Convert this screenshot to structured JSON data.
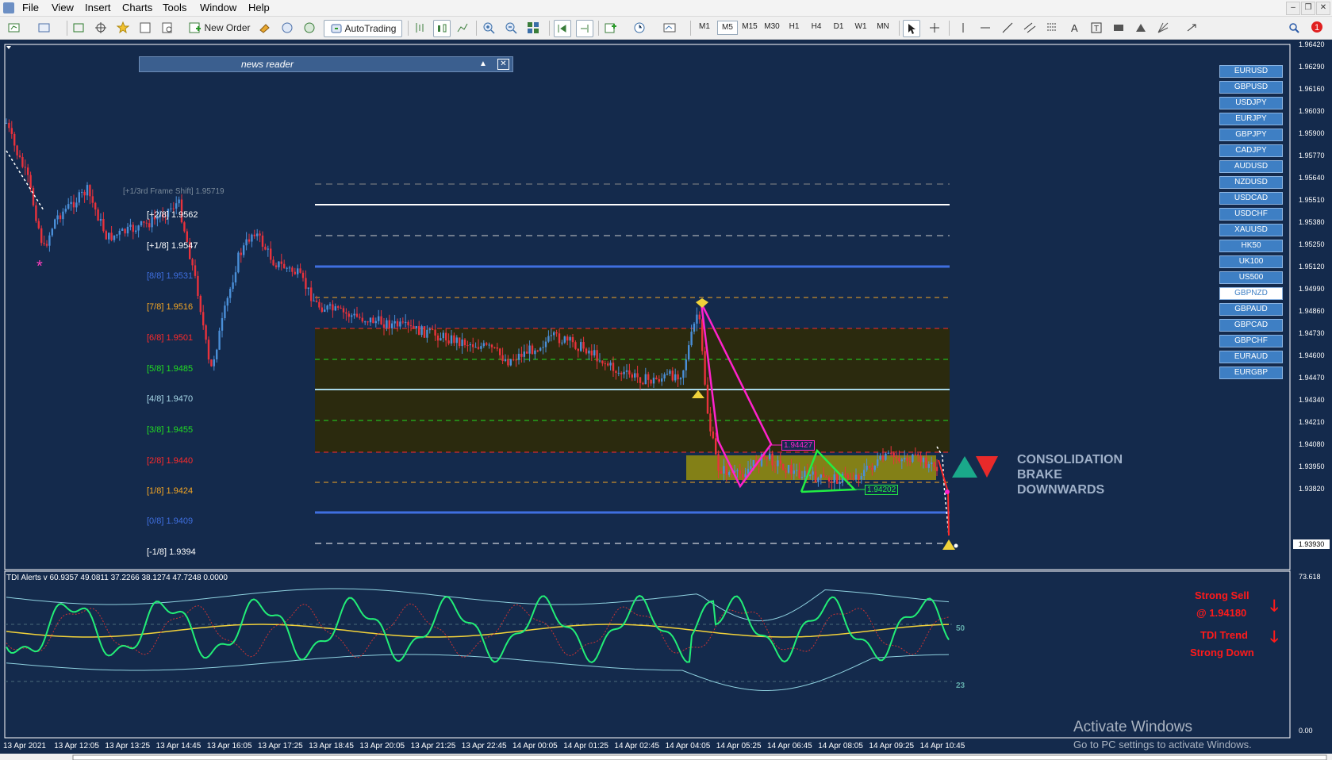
{
  "menu": [
    "File",
    "View",
    "Insert",
    "Charts",
    "Tools",
    "Window",
    "Help"
  ],
  "toolbar": {
    "new_order": "New Order",
    "autotrading": "AutoTrading",
    "timeframes": [
      "M1",
      "M5",
      "M15",
      "M30",
      "H1",
      "H4",
      "D1",
      "W1",
      "MN"
    ],
    "active_timeframe": "M5",
    "notification_count": "1"
  },
  "news_reader": {
    "title": "news reader",
    "minimize": "▲",
    "close": "✕"
  },
  "price_axis": [
    "1.96420",
    "1.96290",
    "1.96160",
    "1.96030",
    "1.95900",
    "1.95770",
    "1.95640",
    "1.95510",
    "1.95380",
    "1.95250",
    "1.95120",
    "1.94990",
    "1.94860",
    "1.94730",
    "1.94600",
    "1.94470",
    "1.94340",
    "1.94210",
    "1.94080",
    "1.93950",
    "1.93820"
  ],
  "current_price": "1.93930",
  "murrey_levels": [
    {
      "tag": "[+1/3rd Frame Shift]",
      "value": "1.95719",
      "color": "#7a8a9a"
    },
    {
      "tag": "[+2/8]",
      "value": "1.9562",
      "color": "#ffffff"
    },
    {
      "tag": "[+1/8]",
      "value": "1.9547",
      "color": "#ffffff"
    },
    {
      "tag": "[8/8]",
      "value": "1.9531",
      "color": "#3f6fe0"
    },
    {
      "tag": "[7/8]",
      "value": "1.9516",
      "color": "#f5a623"
    },
    {
      "tag": "[6/8]",
      "value": "1.9501",
      "color": "#ff2a2a"
    },
    {
      "tag": "[5/8]",
      "value": "1.9485",
      "color": "#22dd22"
    },
    {
      "tag": "[4/8]",
      "value": "1.9470",
      "color": "#a8d8e8"
    },
    {
      "tag": "[3/8]",
      "value": "1.9455",
      "color": "#22dd22"
    },
    {
      "tag": "[2/8]",
      "value": "1.9440",
      "color": "#ff2a2a"
    },
    {
      "tag": "[1/8]",
      "value": "1.9424",
      "color": "#f5a623"
    },
    {
      "tag": "[0/8]",
      "value": "1.9409",
      "color": "#3f6fe0"
    },
    {
      "tag": "[-1/8]",
      "value": "1.9394",
      "color": "#ffffff"
    }
  ],
  "pattern_labels": {
    "upper": "1.94427",
    "lower": "1.94202"
  },
  "pairs": [
    "EURUSD",
    "GBPUSD",
    "USDJPY",
    "EURJPY",
    "GBPJPY",
    "CADJPY",
    "AUDUSD",
    "NZDUSD",
    "USDCAD",
    "USDCHF",
    "XAUUSD",
    "HK50",
    "UK100",
    "US500",
    "GBPNZD",
    "GBPAUD",
    "GBPCAD",
    "GBPCHF",
    "EURAUD",
    "EURGBP"
  ],
  "active_pair": "GBPNZD",
  "consolidation": {
    "line1": "CONSOLIDATION",
    "line2": "BRAKE",
    "line3": "DOWNWARDS"
  },
  "tdi": {
    "header": "TDI Alerts v 60.9357 49.0811 37.2266 38.1274 47.7248 0.0000",
    "top_value": "73.618",
    "bottom_value": "0.00",
    "level_50": "50",
    "level_23": "23"
  },
  "signals": {
    "sell": "Strong Sell",
    "sell_price": "@ 1.94180",
    "trend": "TDI Trend",
    "trend_dir": "Strong Down"
  },
  "time_axis": [
    "13 Apr 2021",
    "13 Apr 12:05",
    "13 Apr 13:25",
    "13 Apr 14:45",
    "13 Apr 16:05",
    "13 Apr 17:25",
    "13 Apr 18:45",
    "13 Apr 20:05",
    "13 Apr 21:25",
    "13 Apr 22:45",
    "14 Apr 00:05",
    "14 Apr 01:25",
    "14 Apr 02:45",
    "14 Apr 04:05",
    "14 Apr 05:25",
    "14 Apr 06:45",
    "14 Apr 08:05",
    "14 Apr 09:25",
    "14 Apr 10:45"
  ],
  "watermark": {
    "line1": "Activate Windows",
    "line2": "Go to PC settings to activate Windows."
  },
  "colors": {
    "background": "#142a4c",
    "bull": "#4a8fd8",
    "bear": "#e8323c",
    "zone": "#2b2a0e",
    "box": "#8f8a12",
    "pattern_upper": "#ff22cc",
    "pattern_lower": "#22ee44"
  }
}
